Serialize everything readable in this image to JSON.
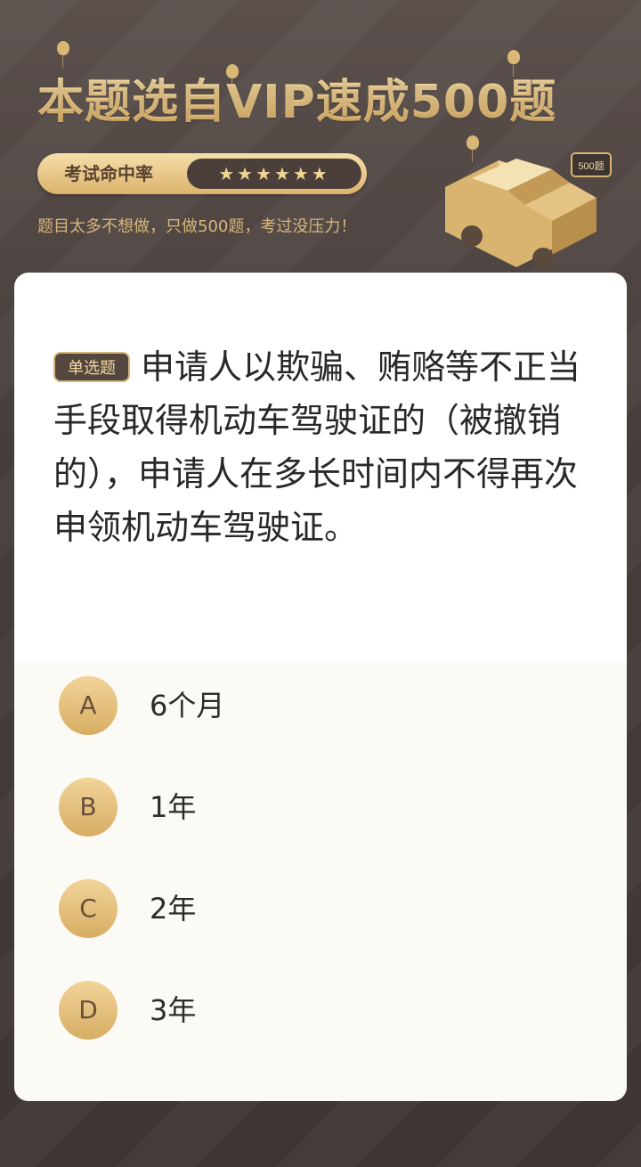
{
  "header": {
    "title": "本题选自VIP速成500题",
    "rate_label": "考试命中率",
    "rate_stars": "★★★★★★",
    "subtitle": "题目太多不想做，只做500题，考过没压力！",
    "car_badge": "500题"
  },
  "question": {
    "type_label": "单选题",
    "text": "申请人以欺骗、贿赂等不正当手段取得机动车驾驶证的（被撤销的），申请人在多长时间内不得再次申领机动车驾驶证。"
  },
  "options": [
    {
      "letter": "A",
      "text": "6个月"
    },
    {
      "letter": "B",
      "text": "1年"
    },
    {
      "letter": "C",
      "text": "2年"
    },
    {
      "letter": "D",
      "text": "3年"
    }
  ],
  "colors": {
    "background": "#4b413e",
    "gold": "#dcb36b",
    "card": "#ffffff"
  }
}
